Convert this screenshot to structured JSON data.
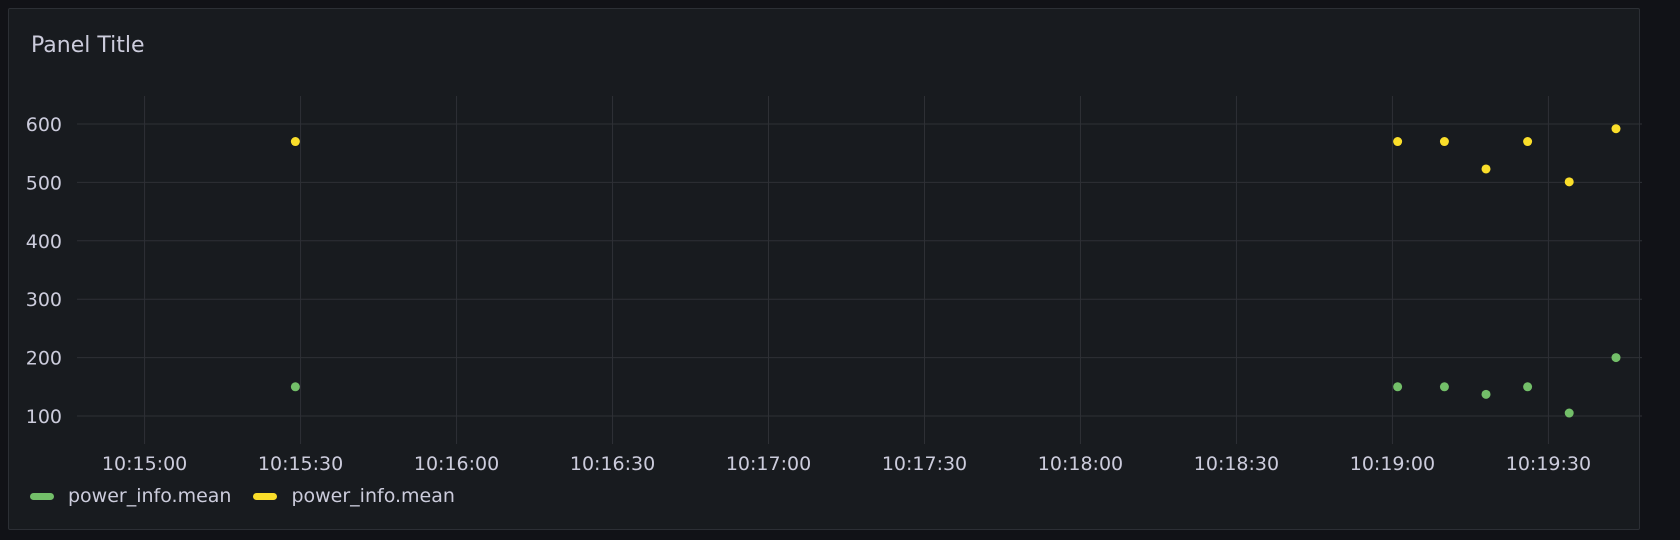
{
  "panel": {
    "title": "Panel Title"
  },
  "colors": {
    "background": "#181b1f",
    "grid": "#2e3036",
    "text": "#ccccdc",
    "series_green": "#73bf69",
    "series_yellow": "#fade2a"
  },
  "chart_data": {
    "type": "scatter",
    "title": "Panel Title",
    "xlabel": "",
    "ylabel": "",
    "xlim": [
      "10:14:47",
      "10:19:48"
    ],
    "ylim": [
      52,
      648
    ],
    "y_ticks": [
      100,
      200,
      300,
      400,
      500,
      600
    ],
    "x_ticks": [
      "10:15:00",
      "10:15:30",
      "10:16:00",
      "10:16:30",
      "10:17:00",
      "10:17:30",
      "10:18:00",
      "10:18:30",
      "10:19:00",
      "10:19:30"
    ],
    "grid": true,
    "legend_position": "bottom-left",
    "series": [
      {
        "name": "power_info.mean",
        "color": "#73bf69",
        "points": [
          {
            "x": "10:15:29",
            "y": 150
          },
          {
            "x": "10:19:01",
            "y": 150
          },
          {
            "x": "10:19:10",
            "y": 150
          },
          {
            "x": "10:19:18",
            "y": 137
          },
          {
            "x": "10:19:26",
            "y": 150
          },
          {
            "x": "10:19:34",
            "y": 105
          },
          {
            "x": "10:19:43",
            "y": 200
          }
        ]
      },
      {
        "name": "power_info.mean",
        "color": "#fade2a",
        "points": [
          {
            "x": "10:15:29",
            "y": 570
          },
          {
            "x": "10:19:01",
            "y": 570
          },
          {
            "x": "10:19:10",
            "y": 570
          },
          {
            "x": "10:19:18",
            "y": 523
          },
          {
            "x": "10:19:26",
            "y": 570
          },
          {
            "x": "10:19:34",
            "y": 501
          },
          {
            "x": "10:19:43",
            "y": 592
          }
        ]
      }
    ]
  }
}
